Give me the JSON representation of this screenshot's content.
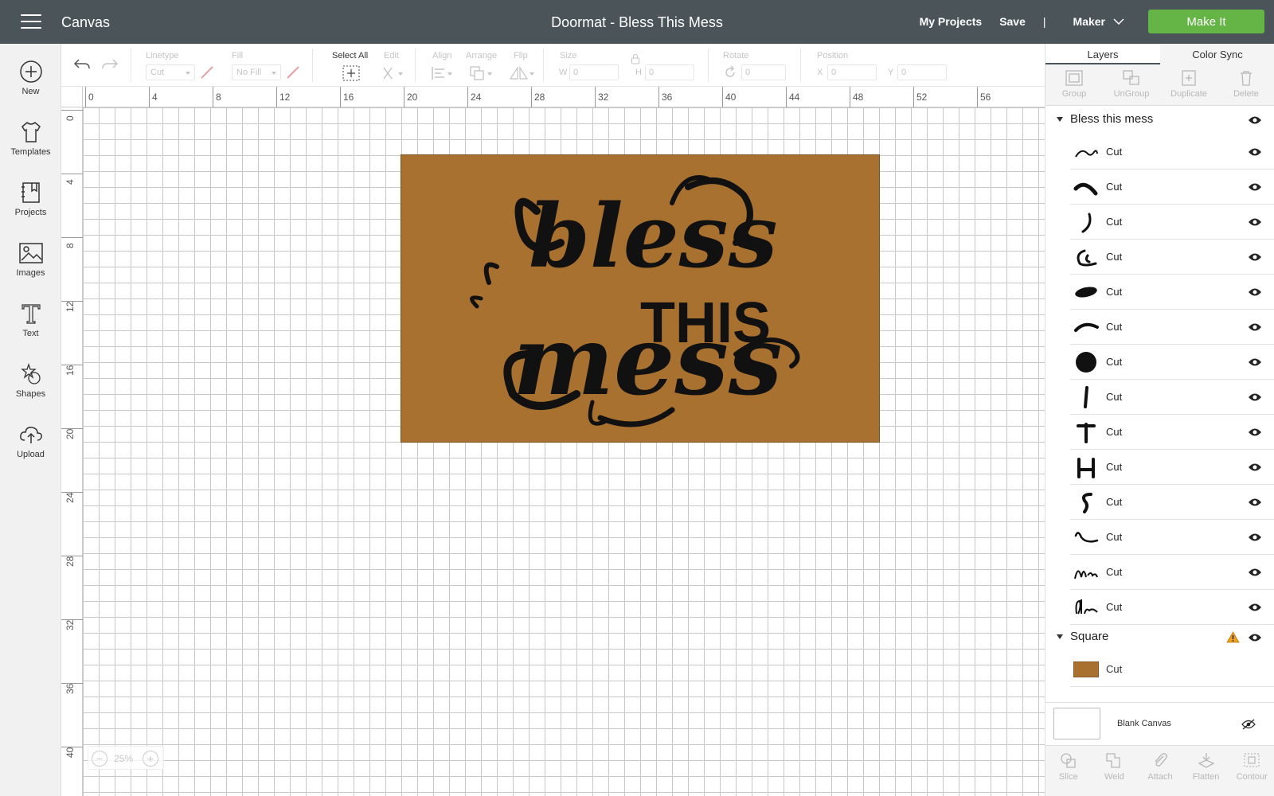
{
  "topbar": {
    "app_title": "Canvas",
    "project_title": "Doormat - Bless This Mess",
    "my_projects": "My Projects",
    "save": "Save",
    "separator": "|",
    "machine": "Maker",
    "make_it": "Make It"
  },
  "leftbar": {
    "items": [
      {
        "label": "New",
        "icon": "plus-circle-icon"
      },
      {
        "label": "Templates",
        "icon": "shirt-icon"
      },
      {
        "label": "Projects",
        "icon": "bookmark-book-icon"
      },
      {
        "label": "Images",
        "icon": "image-icon"
      },
      {
        "label": "Text",
        "icon": "text-t-icon"
      },
      {
        "label": "Shapes",
        "icon": "shapes-icon"
      },
      {
        "label": "Upload",
        "icon": "cloud-upload-icon"
      }
    ]
  },
  "toolbar": {
    "linetype_label": "Linetype",
    "linetype_value": "Cut",
    "fill_label": "Fill",
    "fill_value": "No Fill",
    "select_all_label": "Select All",
    "edit_label": "Edit",
    "align_label": "Align",
    "arrange_label": "Arrange",
    "flip_label": "Flip",
    "size_label": "Size",
    "w_label": "W",
    "w_value": "0",
    "h_label": "H",
    "h_value": "0",
    "rotate_label": "Rotate",
    "rotate_value": "0",
    "position_label": "Position",
    "x_label": "X",
    "x_value": "0",
    "y_label": "Y",
    "y_value": "0"
  },
  "ruler": {
    "top": [
      "0",
      "4",
      "8",
      "12",
      "16",
      "20",
      "24",
      "28",
      "32",
      "36",
      "40",
      "44",
      "48",
      "52",
      "56"
    ],
    "left": [
      "0",
      "4",
      "8",
      "12",
      "16",
      "20",
      "24",
      "28",
      "32",
      "36",
      "40"
    ]
  },
  "canvas": {
    "mat_color": "#a97130",
    "design_text": [
      "bless",
      "THIS",
      "mess"
    ],
    "zoom_value": "25%"
  },
  "right_panel": {
    "tabs": [
      "Layers",
      "Color Sync"
    ],
    "tools": [
      "Group",
      "UnGroup",
      "Duplicate",
      "Delete"
    ],
    "group1": {
      "name": "Bless this mess",
      "layers": [
        "Cut",
        "Cut",
        "Cut",
        "Cut",
        "Cut",
        "Cut",
        "Cut",
        "Cut",
        "Cut",
        "Cut",
        "Cut",
        "Cut",
        "Cut",
        "Cut"
      ]
    },
    "group2": {
      "name": "Square",
      "layers": [
        "Cut"
      ],
      "swatch_color": "#a97130",
      "warning_color": "#f0a020"
    },
    "blank_canvas": "Blank Canvas",
    "bottom_tools": [
      "Slice",
      "Weld",
      "Attach",
      "Flatten",
      "Contour"
    ]
  },
  "colors": {
    "topbar": "#4a5459",
    "make_it": "#64b446"
  }
}
